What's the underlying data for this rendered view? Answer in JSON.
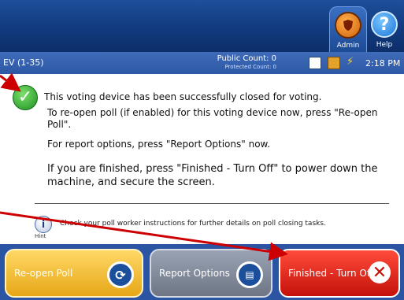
{
  "header": {
    "tabs": [
      {
        "label": "Admin",
        "icon": "shield-icon"
      },
      {
        "label": "Help",
        "icon": "question-icon"
      }
    ]
  },
  "status": {
    "device_label": "EV (1-35)",
    "public_count": "Public Count: 0",
    "protected_count": "Protected Count: 0",
    "time": "2:18 PM"
  },
  "message": {
    "line1": "This voting device has been successfully closed for voting.",
    "line2": "To re-open poll (if enabled) for this voting device now, press \"Re-open Poll\".",
    "line3": "For report options, press \"Report Options\" now.",
    "line4": "If you are finished, press \"Finished - Turn Off\" to power down the machine, and secure the screen.",
    "hint_label": "Hint",
    "hint_text": "Check your poll worker instructions for further details on poll closing tasks."
  },
  "buttons": {
    "reopen": "Re-open Poll",
    "report": "Report Options",
    "finish": "Finished - Turn Off"
  },
  "colors": {
    "header_blue": "#123a7d",
    "reopen_yellow": "#e6a717",
    "report_gray": "#6e7686",
    "finish_red": "#c4120b",
    "arrow_red": "#cc0000"
  }
}
